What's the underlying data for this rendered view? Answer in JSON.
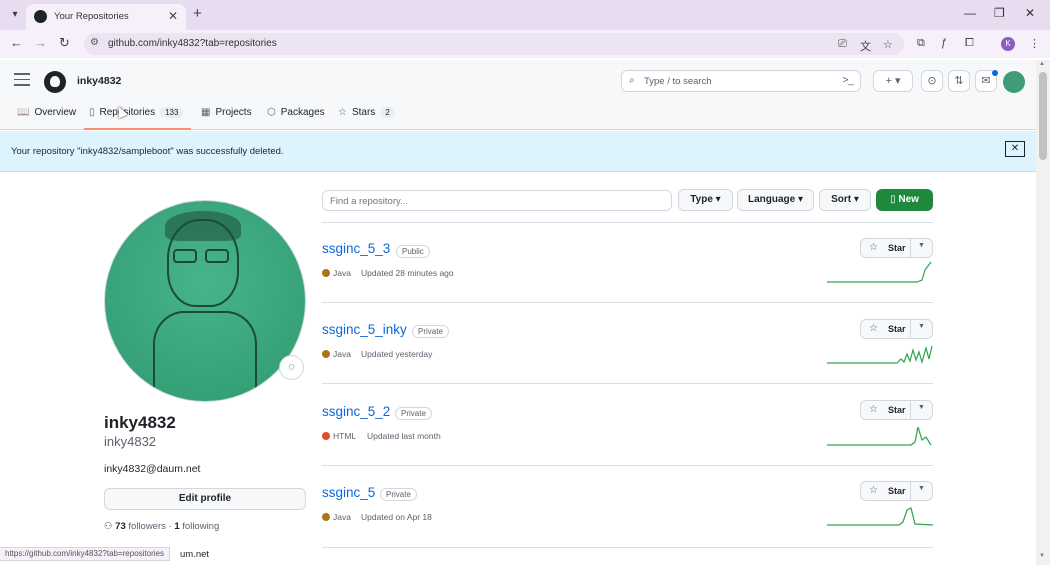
{
  "browser": {
    "tab_title": "Your Repositories",
    "url": "github.com/inky4832?tab=repositories",
    "profile_initial": "K",
    "status_url": "https://github.com/inky4832?tab=repositories"
  },
  "header": {
    "username": "inky4832",
    "search_placeholder": "Type / to search"
  },
  "nav": {
    "overview": "Overview",
    "repositories": "Repositories",
    "repositories_count": "133",
    "projects": "Projects",
    "packages": "Packages",
    "stars": "Stars",
    "stars_count": "2"
  },
  "flash": {
    "message": "Your repository \"inky4832/sampleboot\" was successfully deleted."
  },
  "profile": {
    "display_name": "inky4832",
    "login": "inky4832",
    "email": "inky4832@daum.net",
    "edit_label": "Edit profile",
    "followers_count": "73",
    "followers_label": "followers",
    "following_count": "1",
    "following_label": "following",
    "partial_text": "um.net"
  },
  "filters": {
    "find_placeholder": "Find a repository...",
    "type_label": "Type",
    "language_label": "Language",
    "sort_label": "Sort",
    "new_label": "New"
  },
  "repos": [
    {
      "name": "ssginc_5_3",
      "visibility": "Public",
      "language": "Java",
      "language_color": "#b07219",
      "updated": "Updated 28 minutes ago",
      "star_label": "Star"
    },
    {
      "name": "ssginc_5_inky",
      "visibility": "Private",
      "language": "Java",
      "language_color": "#b07219",
      "updated": "Updated yesterday",
      "star_label": "Star"
    },
    {
      "name": "ssginc_5_2",
      "visibility": "Private",
      "language": "HTML",
      "language_color": "#e34c26",
      "updated": "Updated last month",
      "star_label": "Star"
    },
    {
      "name": "ssginc_5",
      "visibility": "Private",
      "language": "Java",
      "language_color": "#b07219",
      "updated": "Updated on Apr 18",
      "star_label": "Star"
    }
  ],
  "colors": {
    "accent_green": "#1f883d",
    "link_blue": "#0969da",
    "flash_bg": "#ddf4ff",
    "tab_underline": "#fd8c73",
    "sparkline": "#2da44e"
  }
}
